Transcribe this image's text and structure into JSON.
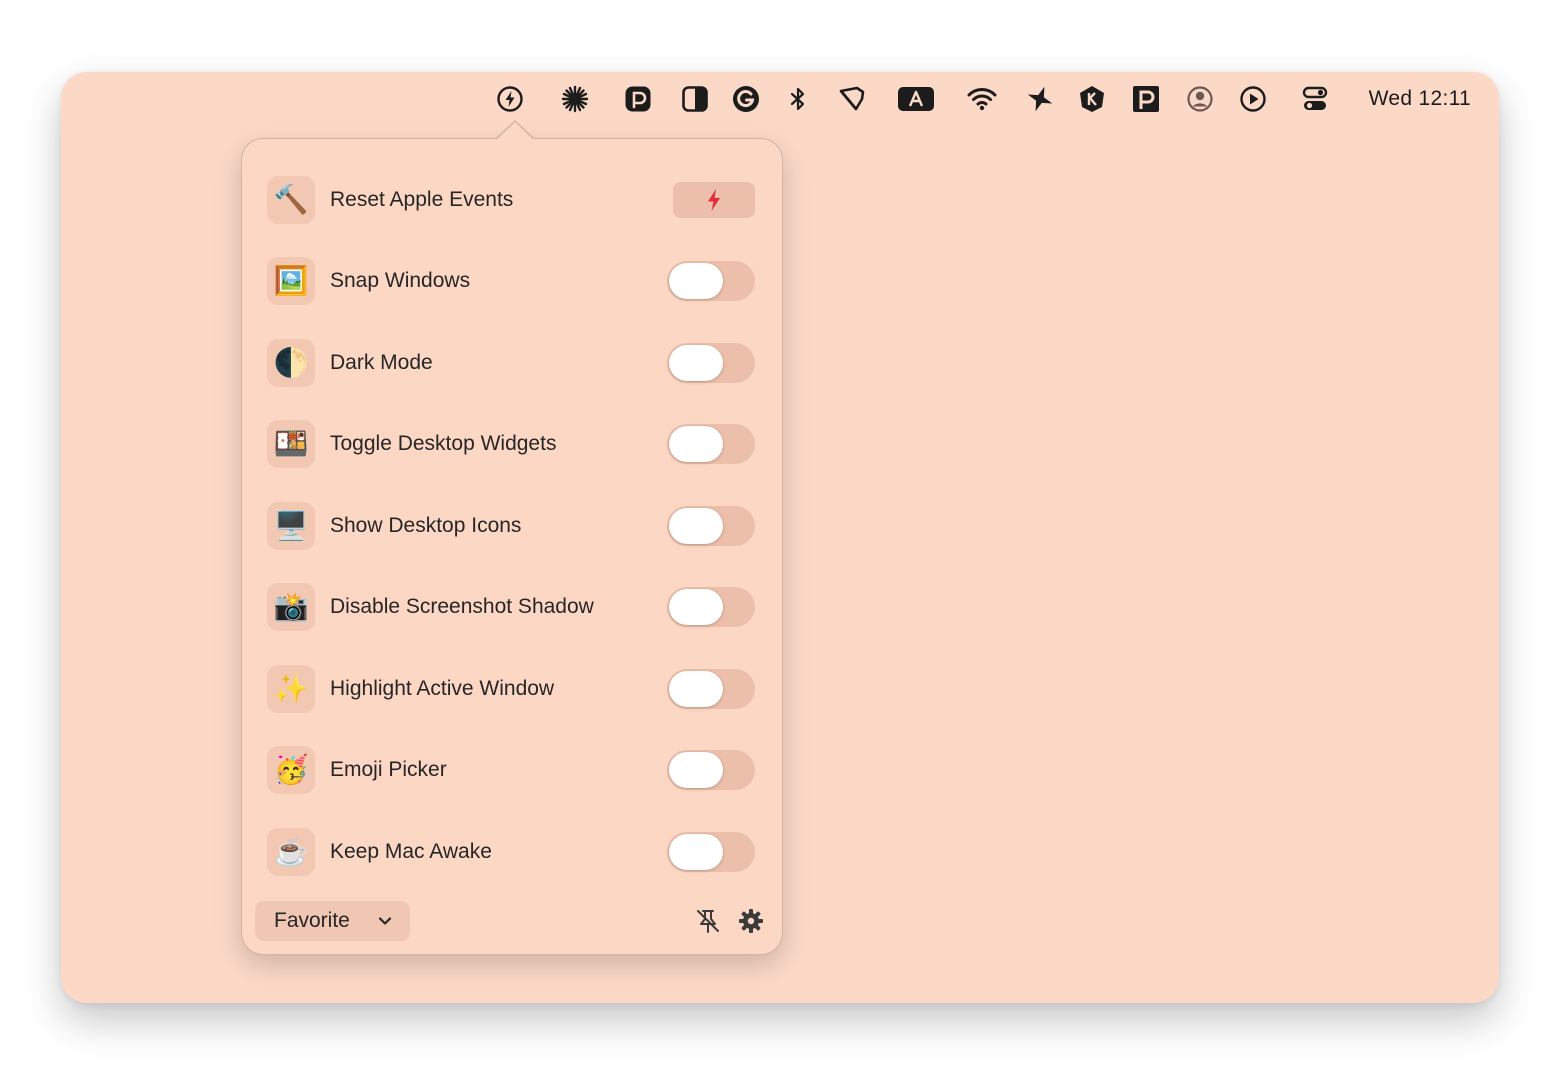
{
  "menubar": {
    "clock": "Wed 12:11",
    "icons": [
      "bolt-circle-icon",
      "asterisk-icon",
      "p-app-icon",
      "contrast-icon",
      "grammarly-icon",
      "bluetooth-icon",
      "flag-icon",
      "keyboard-a-icon",
      "wifi-icon",
      "plane-icon",
      "k-shield-icon",
      "p-square-icon",
      "user-circle-icon",
      "play-circle-icon",
      "control-center-icon"
    ]
  },
  "popover": {
    "items": [
      {
        "label": "Reset Apple Events",
        "icon": "🔨",
        "control": "button"
      },
      {
        "label": "Snap Windows",
        "icon": "🖼️",
        "control": "toggle",
        "on": false
      },
      {
        "label": "Dark Mode",
        "icon": "🌓",
        "control": "toggle",
        "on": false
      },
      {
        "label": "Toggle Desktop Widgets",
        "icon": "🍱",
        "control": "toggle",
        "on": false
      },
      {
        "label": "Show Desktop Icons",
        "icon": "🖥️",
        "control": "toggle",
        "on": false
      },
      {
        "label": "Disable Screenshot Shadow",
        "icon": "📸",
        "control": "toggle",
        "on": false
      },
      {
        "label": "Highlight Active Window",
        "icon": "✨",
        "control": "toggle",
        "on": false
      },
      {
        "label": "Emoji Picker",
        "icon": "🥳",
        "control": "toggle",
        "on": false
      },
      {
        "label": "Keep Mac Awake",
        "icon": "☕",
        "control": "toggle",
        "on": false
      }
    ],
    "footer": {
      "group_select": "Favorite",
      "pin_icon": "pin-slash-icon",
      "settings_icon": "gear-icon"
    },
    "accent_color": "#e8293b"
  }
}
